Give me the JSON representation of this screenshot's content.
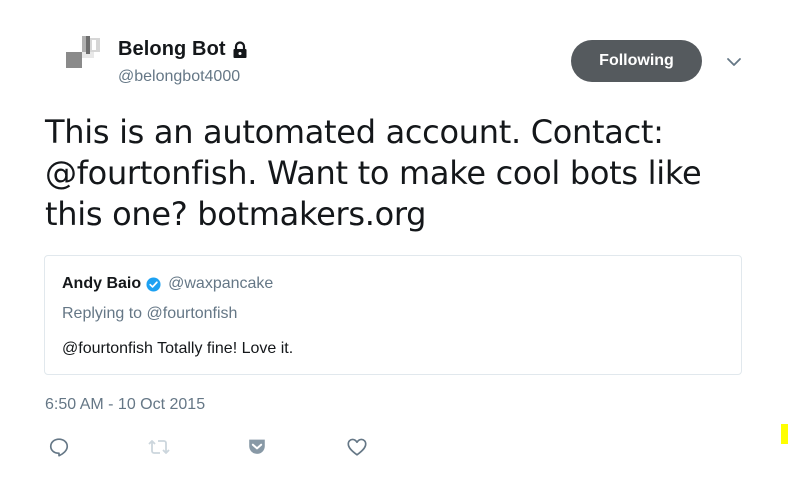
{
  "author": {
    "display_name": "Belong Bot",
    "handle": "@belongbot4000",
    "protected_icon": "lock-icon",
    "avatar_icon": "grey-blocks-avatar"
  },
  "follow_button": {
    "label": "Following",
    "color": "#555a5e"
  },
  "more_menu_icon": "chevron-down-icon",
  "tweet": {
    "text": "This is an automated account. Contact: @fourtonfish. Want to make cool bots like this one? botmakers.org"
  },
  "quoted_tweet": {
    "display_name": "Andy Baio",
    "verified_icon": "verified-badge-icon",
    "handle": "@waxpancake",
    "replying_to_prefix": "Replying to ",
    "replying_to_handle": "@fourtonfish",
    "text": "@fourtonfish Totally fine! Love it."
  },
  "timestamp": "6:50 AM - 10 Oct 2015",
  "actions": [
    {
      "icon": "reply-icon"
    },
    {
      "icon": "retweet-icon"
    },
    {
      "icon": "pocket-icon"
    },
    {
      "icon": "like-icon"
    }
  ],
  "colors": {
    "text_primary": "#14171a",
    "text_secondary": "#657786",
    "border": "#e1e8ed",
    "verified_blue": "#1da1f2",
    "highlight": "#ffff00"
  }
}
